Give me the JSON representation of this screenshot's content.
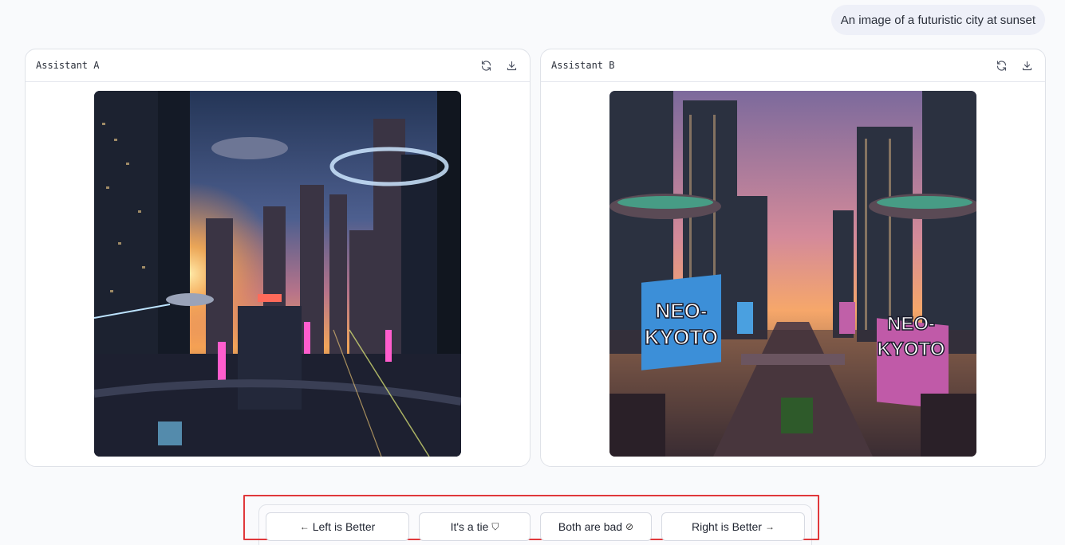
{
  "prompt": {
    "text": "An image of a futuristic city at sunset"
  },
  "panels": [
    {
      "title": "Assistant A",
      "image_icon": "generated-image-futuristic-city",
      "tools": [
        "refresh-icon",
        "download-icon"
      ]
    },
    {
      "title": "Assistant B",
      "image_icon": "generated-image-neo-kyoto",
      "sign_text_1": "NEO-",
      "sign_text_2": "KYOTO",
      "tools": [
        "refresh-icon",
        "download-icon"
      ]
    }
  ],
  "vote": {
    "left_label": "Left is Better",
    "left_icon": "←",
    "tie_label": "It's a tie",
    "tie_icon": "⛉",
    "bad_label": "Both are bad",
    "bad_icon": "⊘",
    "right_label": "Right is Better",
    "right_icon": "→"
  },
  "colors": {
    "highlight": "#e0383b",
    "bubble": "#eef0f8"
  }
}
